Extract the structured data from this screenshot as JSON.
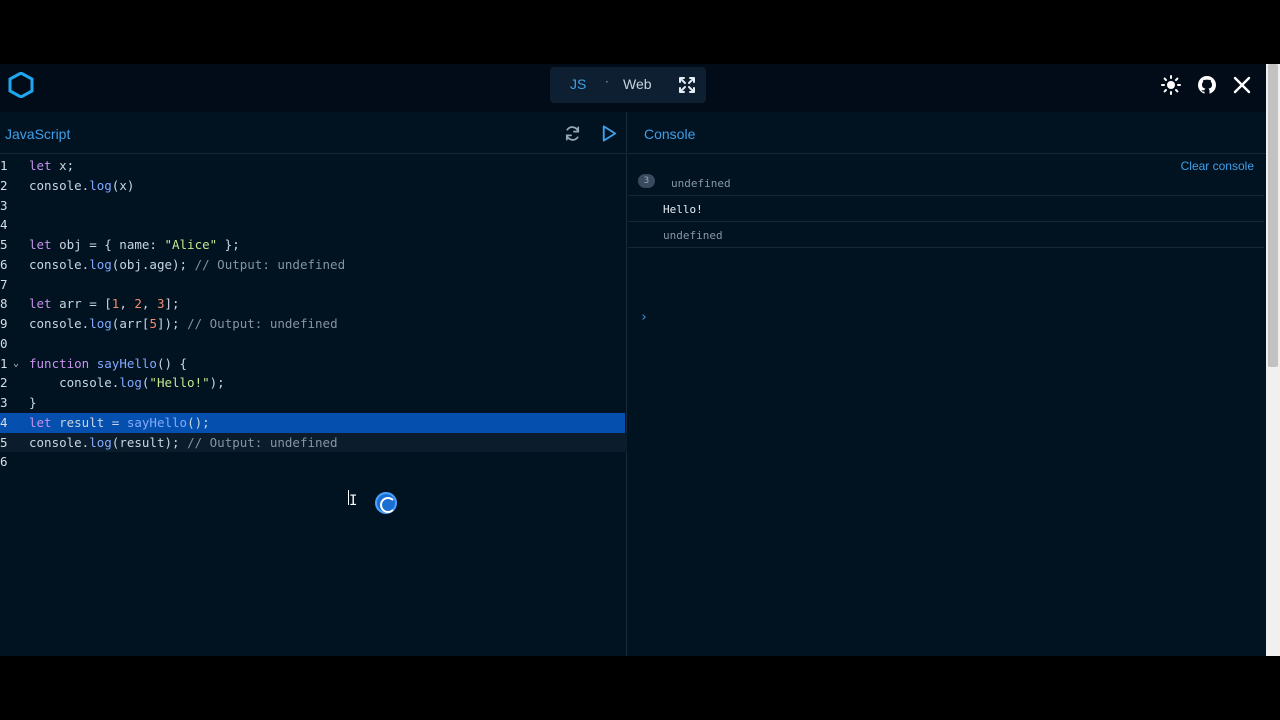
{
  "header": {
    "mode_js": "JS",
    "mode_sep": "·",
    "mode_web": "Web",
    "accent": "#3fa0e8"
  },
  "editor": {
    "title": "JavaScript",
    "lines": [
      {
        "n": "1",
        "code": [
          [
            "kw",
            "let"
          ],
          [
            "pl",
            " x;"
          ]
        ]
      },
      {
        "n": "2",
        "code": [
          [
            "pl",
            "console."
          ],
          [
            "fn",
            "log"
          ],
          [
            "pl",
            "(x)"
          ]
        ]
      },
      {
        "n": "3",
        "code": []
      },
      {
        "n": "4",
        "code": []
      },
      {
        "n": "5",
        "code": [
          [
            "kw",
            "let"
          ],
          [
            "pl",
            " obj = { name: "
          ],
          [
            "str",
            "\"Alice\""
          ],
          [
            "pl",
            " };"
          ]
        ]
      },
      {
        "n": "6",
        "code": [
          [
            "pl",
            "console."
          ],
          [
            "fn",
            "log"
          ],
          [
            "pl",
            "(obj.age); "
          ],
          [
            "cm",
            "// Output: undefined"
          ]
        ]
      },
      {
        "n": "7",
        "code": []
      },
      {
        "n": "8",
        "code": [
          [
            "kw",
            "let"
          ],
          [
            "pl",
            " arr = ["
          ],
          [
            "num",
            "1"
          ],
          [
            "pl",
            ", "
          ],
          [
            "num",
            "2"
          ],
          [
            "pl",
            ", "
          ],
          [
            "num",
            "3"
          ],
          [
            "pl",
            "];"
          ]
        ]
      },
      {
        "n": "9",
        "code": [
          [
            "pl",
            "console."
          ],
          [
            "fn",
            "log"
          ],
          [
            "pl",
            "(arr["
          ],
          [
            "num",
            "5"
          ],
          [
            "pl",
            "]); "
          ],
          [
            "cm",
            "// Output: undefined"
          ]
        ]
      },
      {
        "n": "0",
        "code": []
      },
      {
        "n": "1",
        "code": [
          [
            "kw",
            "function"
          ],
          [
            "pl",
            " "
          ],
          [
            "fn",
            "sayHello"
          ],
          [
            "pl",
            "() {"
          ]
        ],
        "fold": true
      },
      {
        "n": "2",
        "code": [
          [
            "pl",
            "    console."
          ],
          [
            "fn",
            "log"
          ],
          [
            "pl",
            "("
          ],
          [
            "str",
            "\"Hello!\""
          ],
          [
            "pl",
            ");"
          ]
        ]
      },
      {
        "n": "3",
        "code": [
          [
            "pl",
            "}"
          ]
        ]
      },
      {
        "n": "4",
        "code": [
          [
            "kw",
            "let"
          ],
          [
            "pl",
            " result = "
          ],
          [
            "fn",
            "sayHello"
          ],
          [
            "pl",
            "();"
          ]
        ],
        "selected": true
      },
      {
        "n": "5",
        "code": [
          [
            "pl",
            "console."
          ],
          [
            "fn",
            "log"
          ],
          [
            "pl",
            "(result); "
          ],
          [
            "cm",
            "// Output: undefined"
          ]
        ],
        "active": true
      },
      {
        "n": "6",
        "code": []
      }
    ]
  },
  "console": {
    "title": "Console",
    "clear_label": "Clear console",
    "entries": [
      {
        "badge": "3",
        "text": "undefined",
        "color": "#8a97a3"
      },
      {
        "badge": "",
        "text": "Hello!",
        "color": "#e6edf3"
      },
      {
        "badge": "",
        "text": "undefined",
        "color": "#8a97a3"
      }
    ],
    "prompt": "›"
  }
}
